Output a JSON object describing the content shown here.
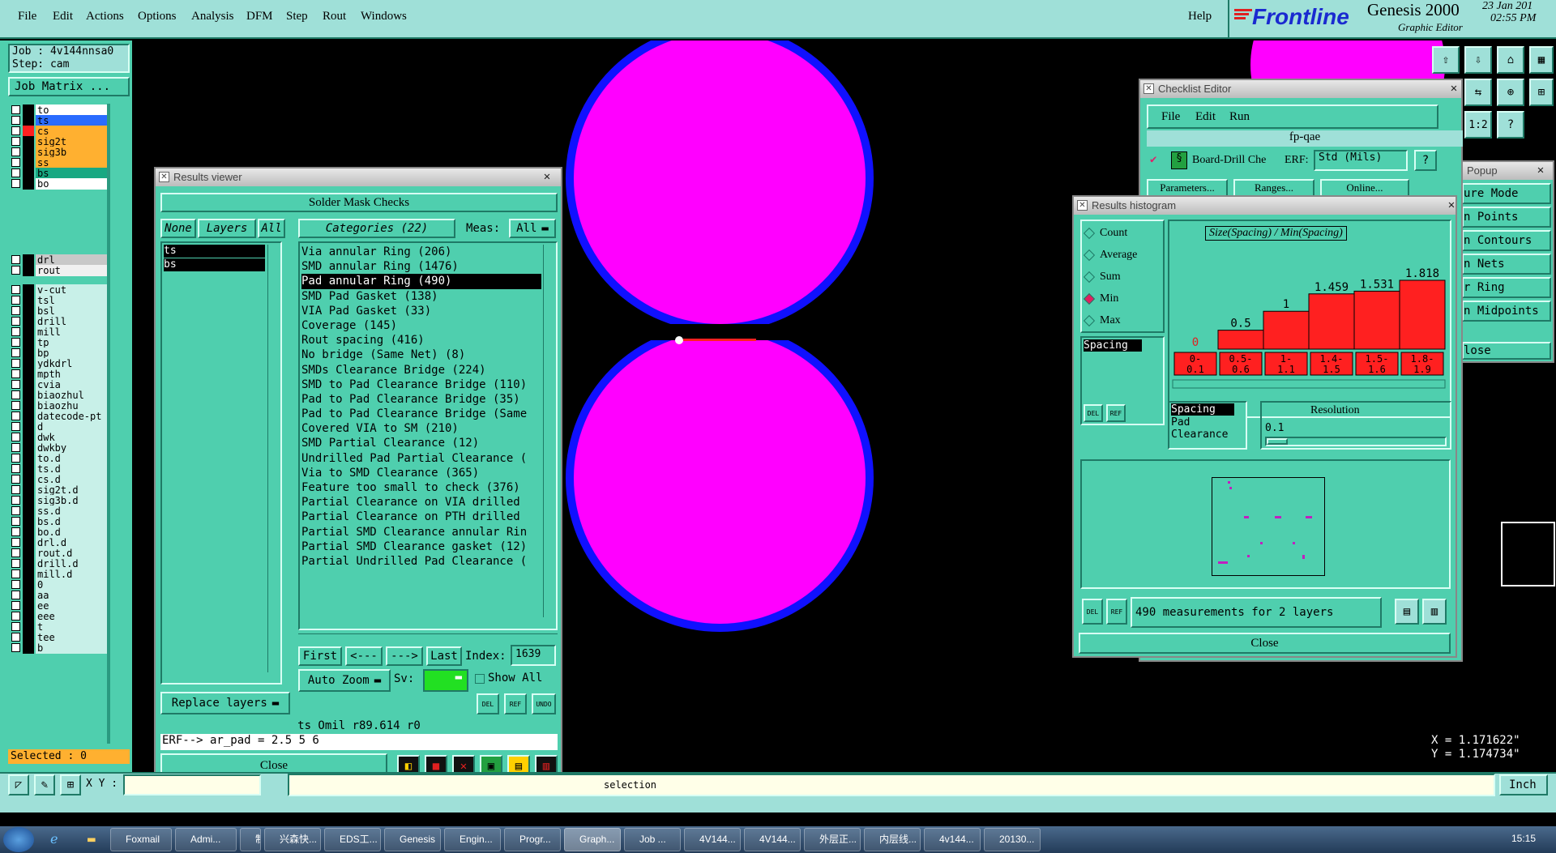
{
  "menu": [
    "File",
    "Edit",
    "Actions",
    "Options",
    "Analysis",
    "DFM",
    "Step",
    "Rout",
    "Windows"
  ],
  "help": "Help",
  "brand": {
    "logo": "Frontline",
    "product": "Genesis 2000",
    "subtitle": "Graphic Editor",
    "date": "23 Jan 201",
    "time": "02:55 PM"
  },
  "job": {
    "job": "Job : 4v144nnsa0",
    "step": "Step: cam",
    "matrix_button": "Job Matrix ..."
  },
  "layers_top": [
    {
      "name": "to",
      "color": "#ffffff"
    },
    {
      "name": "ts",
      "color": "#2a6cff"
    },
    {
      "name": "cs",
      "color": "#ffb030"
    },
    {
      "name": "sig2t",
      "color": "#ffb030"
    },
    {
      "name": "sig3b",
      "color": "#ffb030"
    },
    {
      "name": "ss",
      "color": "#ffb030"
    },
    {
      "name": "bs",
      "color": "#18a882"
    },
    {
      "name": "bo",
      "color": "#ffffff"
    }
  ],
  "layers_mid": [
    {
      "name": "drl",
      "color": "#c8c8c8"
    },
    {
      "name": "rout",
      "color": "#f0f0f0"
    }
  ],
  "layers_bottom": [
    "v-cut",
    "tsl",
    "bsl",
    "drill",
    "mill",
    "tp",
    "bp",
    "ydkdrl",
    "mpth",
    "cvia",
    "biaozhul",
    "biaozhu",
    "datecode-pt",
    "d",
    "dwk",
    "dwkby",
    "to.d",
    "ts.d",
    "cs.d",
    "sig2t.d",
    "sig3b.d",
    "ss.d",
    "bs.d",
    "bo.d",
    "drl.d",
    "rout.d",
    "drill.d",
    "mill.d",
    "0",
    "aa",
    "ee",
    "eee",
    "t",
    "tee",
    "b"
  ],
  "selected": "Selected : 0",
  "results_viewer": {
    "title": "Results viewer",
    "header": "Solder Mask Checks",
    "none_btn": "None",
    "layers_btn": "Layers",
    "all_btn": "All",
    "categories_label": "Categories (22)",
    "meas_label": "Meas:",
    "meas_value": "All",
    "layers": [
      "ts",
      "bs"
    ],
    "categories": [
      "Via annular Ring (206)",
      "SMD annular Ring (1476)",
      "Pad annular Ring (490)",
      "SMD Pad Gasket (138)",
      "VIA Pad Gasket (33)",
      "Coverage (145)",
      "Rout spacing (416)",
      "No bridge (Same Net) (8)",
      "SMDs Clearance Bridge (224)",
      "SMD to Pad Clearance Bridge (110)",
      "Pad to Pad Clearance Bridge (35)",
      "Pad to Pad Clearance Bridge (Same",
      "Covered VIA to SM (210)",
      "SMD Partial Clearance (12)",
      "Undrilled Pad Partial Clearance (",
      "Via to SMD Clearance (365)",
      "Feature too small to check (376)",
      "Partial Clearance on VIA drilled",
      "Partial Clearance on PTH drilled",
      "Partial SMD Clearance annular Rin",
      "Partial SMD Clearance gasket (12)",
      "Partial Undrilled Pad Clearance ("
    ],
    "nav": [
      "First",
      "<---",
      "--->",
      "Last"
    ],
    "index_label": "Index:",
    "index_value": "1639",
    "auto_zoom": "Auto Zoom",
    "sv_label": "Sv:",
    "show_all": "Show All",
    "replace_layers": "Replace layers",
    "status1": "ts  Omil  r89.614  r0",
    "status2": "ERF--> ar_pad = 2.5 5 6",
    "close": "Close",
    "small_btns": [
      "DEL",
      "REF",
      "UNDO"
    ]
  },
  "checklist_editor": {
    "title": "Checklist Editor",
    "menu": [
      "File",
      "Edit",
      "Run"
    ],
    "name": "fp-qae",
    "row": "Board-Drill Che",
    "erf_label": "ERF:",
    "erf_value": "Std (Mils)",
    "buttons": [
      "Parameters...",
      "Ranges...",
      "Online..."
    ]
  },
  "histogram": {
    "title": "Results histogram",
    "modes": [
      "Count",
      "Average",
      "Sum",
      "Min",
      "Max"
    ],
    "selected_mode": "Min",
    "chart_title": "Size(Spacing) / Min(Spacing)",
    "left_list": [
      "Spacing"
    ],
    "bottom_list": [
      "Spacing",
      "Pad",
      "Clearance"
    ],
    "resolution_label": "Resolution",
    "resolution_value": "0.1",
    "measurements": "490 measurements for 2 layers",
    "close": "Close",
    "del": "DEL",
    "ref": "REF"
  },
  "chart_data": {
    "type": "bar",
    "title": "Size(Spacing) / Min(Spacing)",
    "categories": [
      "0-0.1",
      "0.5-0.6",
      "1-1.1",
      "1.4-1.5",
      "1.5-1.6",
      "1.8-1.9"
    ],
    "value_labels": [
      "0",
      "0.5",
      "1",
      "1.459",
      "1.531",
      "1.818"
    ],
    "values": [
      0,
      0.5,
      1,
      1.459,
      1.531,
      1.818
    ]
  },
  "popup": {
    "title": "Popup",
    "items": [
      "ure Mode",
      "n Points",
      "n Contours",
      "n Nets",
      "r Ring",
      "n Midpoints"
    ],
    "close": "lose"
  },
  "coords": {
    "x": "X = 1.171622\"",
    "y": "Y = 1.174734\""
  },
  "xy_label": "X Y :",
  "bottom_message": "selection",
  "units": "Inch",
  "taskbar": [
    "Foxmail",
    "Admi...",
    "制作规...",
    "兴森快...",
    "EDS工...",
    "Genesis",
    "Engin...",
    "Progr...",
    "Graph...",
    "Job ...",
    "4V144...",
    "4V144...",
    "外层正...",
    "内层线...",
    "4v144...",
    "20130..."
  ],
  "clock": "15:15",
  "colors": {
    "teal": "#4fcfae",
    "pad": "#ff00ff",
    "ring": "#1010ff",
    "bar": "#ff2020"
  }
}
